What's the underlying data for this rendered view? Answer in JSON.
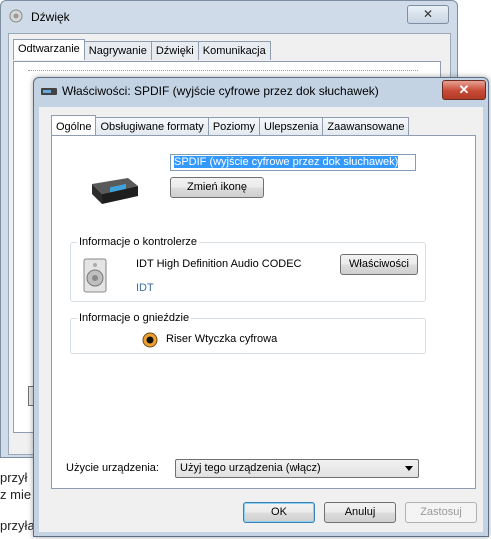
{
  "background_window": {
    "title": "Dźwięk",
    "close_label": "✕",
    "tabs": [
      "Odtwarzanie",
      "Nagrywanie",
      "Dźwięki",
      "Komunikacja"
    ],
    "active_tab": 0
  },
  "left_fragments": [
    "przył",
    "z mie",
    "przyła"
  ],
  "dialog": {
    "title": "Właściwości: SPDIF (wyjście cyfrowe przez dok słuchawek)",
    "close_label": "✕",
    "tabs": [
      "Ogólne",
      "Obsługiwane formaty",
      "Poziomy",
      "Ulepszenia",
      "Zaawansowane"
    ],
    "device_name_value": "SPDIF (wyjście cyfrowe przez dok słuchawek)",
    "change_icon_label": "Zmień ikonę",
    "controller": {
      "group_label": "Informacje o kontrolerze",
      "name": "IDT High Definition Audio CODEC",
      "vendor": "IDT",
      "properties_label": "Właściwości"
    },
    "jack": {
      "group_label": "Informacje o gnieździe",
      "label": "Riser Wtyczka cyfrowa"
    },
    "usage": {
      "label": "Użycie urządzenia:",
      "selected": "Użyj tego urządzenia (włącz)"
    },
    "buttons": {
      "ok": "OK",
      "cancel": "Anuluj",
      "apply": "Zastosuj"
    }
  }
}
